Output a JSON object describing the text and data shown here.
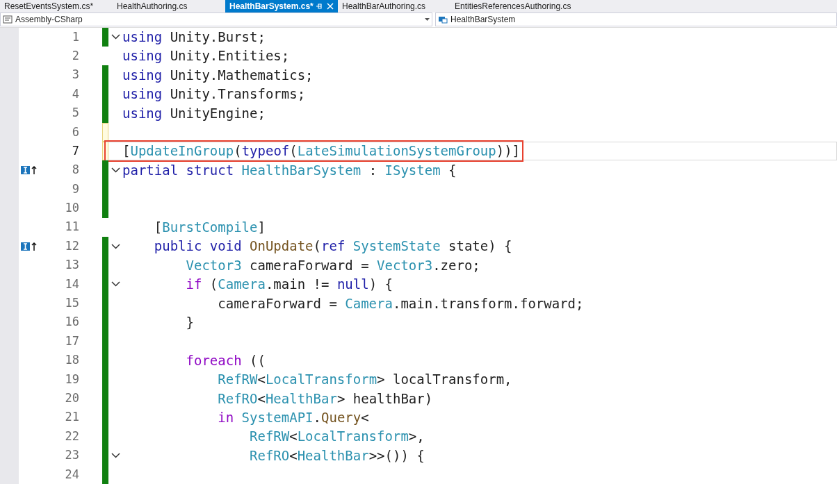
{
  "tabs": [
    {
      "label": "ResetEventsSystem.cs*",
      "selected": false
    },
    {
      "label": "HealthAuthoring.cs",
      "selected": false
    },
    {
      "label": "HealthBarSystem.cs*",
      "selected": true
    },
    {
      "label": "HealthBarAuthoring.cs",
      "selected": false
    },
    {
      "label": "EntitiesReferencesAuthoring.cs",
      "selected": false
    }
  ],
  "nav": {
    "project": "Assembly-CSharp",
    "type": "HealthBarSystem"
  },
  "lines": [
    {
      "number": "1",
      "changed": true,
      "unsaved": false,
      "fold": true,
      "implements": false,
      "current": false,
      "highlighted": false,
      "tokens": [
        {
          "t": "using",
          "kind": "keyword"
        },
        {
          "t": " Unity.Burst;",
          "kind": "plain"
        }
      ]
    },
    {
      "number": "2",
      "changed": false,
      "unsaved": false,
      "fold": false,
      "implements": false,
      "current": false,
      "highlighted": false,
      "tokens": [
        {
          "t": "using",
          "kind": "keyword"
        },
        {
          "t": " Unity.Entities;",
          "kind": "plain"
        }
      ]
    },
    {
      "number": "3",
      "changed": true,
      "unsaved": false,
      "fold": false,
      "implements": false,
      "current": false,
      "highlighted": false,
      "tokens": [
        {
          "t": "using",
          "kind": "keyword"
        },
        {
          "t": " Unity.Mathematics;",
          "kind": "plain"
        }
      ]
    },
    {
      "number": "4",
      "changed": true,
      "unsaved": false,
      "fold": false,
      "implements": false,
      "current": false,
      "highlighted": false,
      "tokens": [
        {
          "t": "using",
          "kind": "keyword"
        },
        {
          "t": " Unity.Transforms;",
          "kind": "plain"
        }
      ]
    },
    {
      "number": "5",
      "changed": true,
      "unsaved": false,
      "fold": false,
      "implements": false,
      "current": false,
      "highlighted": false,
      "tokens": [
        {
          "t": "using",
          "kind": "keyword"
        },
        {
          "t": " UnityEngine;",
          "kind": "plain"
        }
      ]
    },
    {
      "number": "6",
      "changed": true,
      "unsaved": true,
      "fold": false,
      "implements": false,
      "current": false,
      "highlighted": false
    },
    {
      "number": "7",
      "changed": true,
      "unsaved": true,
      "fold": false,
      "implements": false,
      "current": true,
      "highlighted": true,
      "tokens": [
        {
          "t": "[",
          "kind": "plain"
        },
        {
          "t": "UpdateInGroup",
          "kind": "type"
        },
        {
          "t": "(",
          "kind": "plain"
        },
        {
          "t": "typeof",
          "kind": "keyword"
        },
        {
          "t": "(",
          "kind": "plain"
        },
        {
          "t": "LateSimulationSystemGroup",
          "kind": "type"
        },
        {
          "t": "))]",
          "kind": "plain"
        }
      ]
    },
    {
      "number": "8",
      "changed": true,
      "unsaved": false,
      "fold": true,
      "implements": true,
      "current": false,
      "highlighted": false,
      "tokens": [
        {
          "t": "partial",
          "kind": "keyword"
        },
        {
          "t": " struct",
          "kind": "keyword"
        },
        {
          "t": " HealthBarSystem",
          "kind": "type"
        },
        {
          "t": " : ",
          "kind": "plain"
        },
        {
          "t": "ISystem",
          "kind": "type"
        },
        {
          "t": " {",
          "kind": "plain"
        }
      ]
    },
    {
      "number": "9",
      "changed": true,
      "unsaved": false,
      "fold": false,
      "implements": false,
      "current": false,
      "highlighted": false
    },
    {
      "number": "10",
      "changed": true,
      "unsaved": false,
      "fold": false,
      "implements": false,
      "current": false,
      "highlighted": false
    },
    {
      "number": "11",
      "changed": false,
      "unsaved": false,
      "fold": false,
      "implements": false,
      "current": false,
      "highlighted": false,
      "tokens": [
        {
          "t": "    [",
          "kind": "plain"
        },
        {
          "t": "BurstCompile",
          "kind": "type"
        },
        {
          "t": "]",
          "kind": "plain"
        }
      ]
    },
    {
      "number": "12",
      "changed": true,
      "unsaved": false,
      "fold": true,
      "implements": true,
      "current": false,
      "highlighted": false,
      "tokens": [
        {
          "t": "    public",
          "kind": "keyword"
        },
        {
          "t": " void",
          "kind": "keyword"
        },
        {
          "t": " OnUpdate",
          "kind": "method"
        },
        {
          "t": "(",
          "kind": "plain"
        },
        {
          "t": "ref",
          "kind": "keyword"
        },
        {
          "t": " SystemState",
          "kind": "type"
        },
        {
          "t": " state) {",
          "kind": "plain"
        }
      ]
    },
    {
      "number": "13",
      "changed": true,
      "unsaved": false,
      "fold": false,
      "implements": false,
      "current": false,
      "highlighted": false,
      "tokens": [
        {
          "t": "        Vector3",
          "kind": "type"
        },
        {
          "t": " cameraForward = ",
          "kind": "plain"
        },
        {
          "t": "Vector3",
          "kind": "type"
        },
        {
          "t": ".zero;",
          "kind": "plain"
        }
      ]
    },
    {
      "number": "14",
      "changed": true,
      "unsaved": false,
      "fold": true,
      "implements": false,
      "current": false,
      "highlighted": false,
      "tokens": [
        {
          "t": "        if",
          "kind": "control"
        },
        {
          "t": " (",
          "kind": "plain"
        },
        {
          "t": "Camera",
          "kind": "type"
        },
        {
          "t": ".main != ",
          "kind": "plain"
        },
        {
          "t": "null",
          "kind": "keyword"
        },
        {
          "t": ") {",
          "kind": "plain"
        }
      ]
    },
    {
      "number": "15",
      "changed": true,
      "unsaved": false,
      "fold": false,
      "implements": false,
      "current": false,
      "highlighted": false,
      "tokens": [
        {
          "t": "            cameraForward = ",
          "kind": "plain"
        },
        {
          "t": "Camera",
          "kind": "type"
        },
        {
          "t": ".main.transform.forward;",
          "kind": "plain"
        }
      ]
    },
    {
      "number": "16",
      "changed": true,
      "unsaved": false,
      "fold": false,
      "implements": false,
      "current": false,
      "highlighted": false,
      "tokens": [
        {
          "t": "        }",
          "kind": "plain"
        }
      ]
    },
    {
      "number": "17",
      "changed": true,
      "unsaved": false,
      "fold": false,
      "implements": false,
      "current": false,
      "highlighted": false
    },
    {
      "number": "18",
      "changed": true,
      "unsaved": false,
      "fold": false,
      "implements": false,
      "current": false,
      "highlighted": false,
      "tokens": [
        {
          "t": "        foreach",
          "kind": "control"
        },
        {
          "t": " ((",
          "kind": "plain"
        }
      ]
    },
    {
      "number": "19",
      "changed": true,
      "unsaved": false,
      "fold": false,
      "implements": false,
      "current": false,
      "highlighted": false,
      "tokens": [
        {
          "t": "            RefRW",
          "kind": "type"
        },
        {
          "t": "<",
          "kind": "plain"
        },
        {
          "t": "LocalTransform",
          "kind": "type"
        },
        {
          "t": "> localTransform,",
          "kind": "plain"
        }
      ]
    },
    {
      "number": "20",
      "changed": true,
      "unsaved": false,
      "fold": false,
      "implements": false,
      "current": false,
      "highlighted": false,
      "tokens": [
        {
          "t": "            RefRO",
          "kind": "type"
        },
        {
          "t": "<",
          "kind": "plain"
        },
        {
          "t": "HealthBar",
          "kind": "type"
        },
        {
          "t": "> healthBar)",
          "kind": "plain"
        }
      ]
    },
    {
      "number": "21",
      "changed": true,
      "unsaved": false,
      "fold": false,
      "implements": false,
      "current": false,
      "highlighted": false,
      "tokens": [
        {
          "t": "            in",
          "kind": "control"
        },
        {
          "t": " SystemAPI",
          "kind": "type"
        },
        {
          "t": ".",
          "kind": "plain"
        },
        {
          "t": "Query",
          "kind": "method"
        },
        {
          "t": "<",
          "kind": "plain"
        }
      ]
    },
    {
      "number": "22",
      "changed": true,
      "unsaved": false,
      "fold": false,
      "implements": false,
      "current": false,
      "highlighted": false,
      "tokens": [
        {
          "t": "                RefRW",
          "kind": "type"
        },
        {
          "t": "<",
          "kind": "plain"
        },
        {
          "t": "LocalTransform",
          "kind": "type"
        },
        {
          "t": ">,",
          "kind": "plain"
        }
      ]
    },
    {
      "number": "23",
      "changed": true,
      "unsaved": false,
      "fold": true,
      "implements": false,
      "current": false,
      "highlighted": false,
      "tokens": [
        {
          "t": "                RefRO",
          "kind": "type"
        },
        {
          "t": "<",
          "kind": "plain"
        },
        {
          "t": "HealthBar",
          "kind": "type"
        },
        {
          "t": ">>()) {",
          "kind": "plain"
        }
      ]
    },
    {
      "number": "24",
      "changed": true,
      "unsaved": false,
      "fold": false,
      "implements": false,
      "current": false,
      "highlighted": false
    }
  ]
}
